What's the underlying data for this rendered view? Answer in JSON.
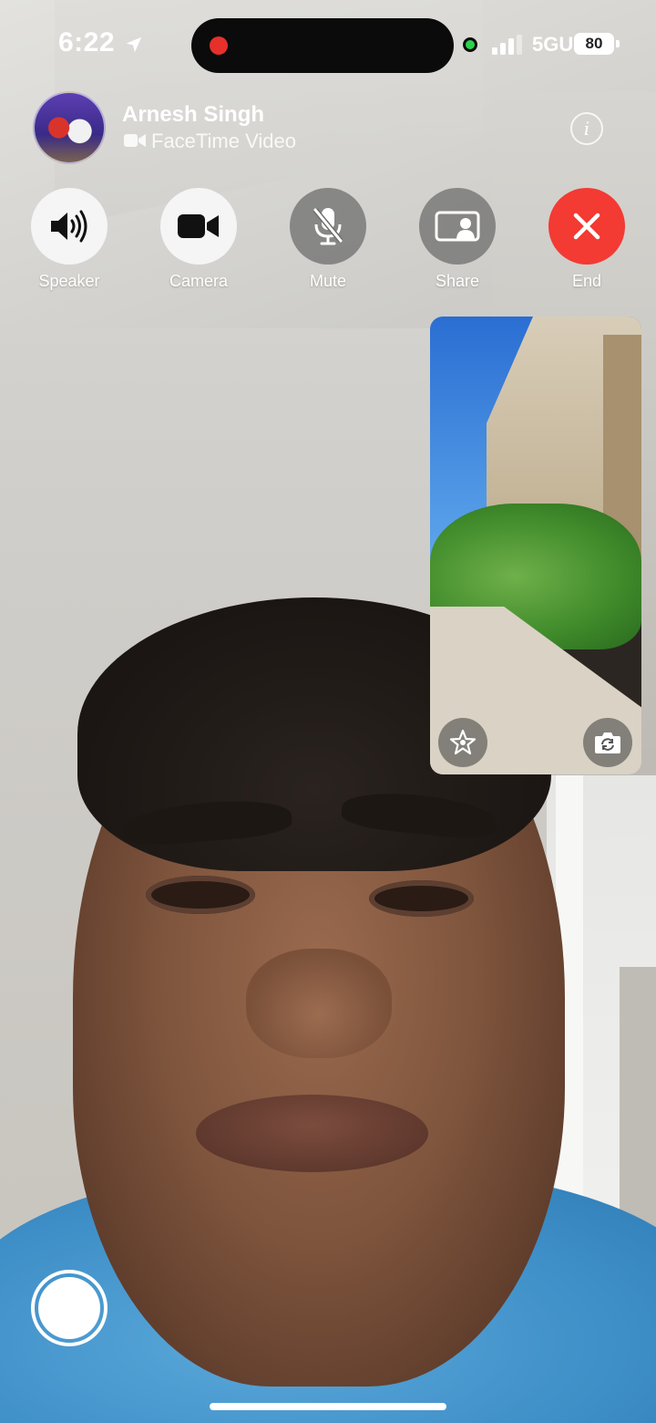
{
  "status_bar": {
    "time": "6:22",
    "network": "5GUC",
    "battery": "80",
    "battery_percent": 80,
    "recording_indicator_color": "#e5302b",
    "camera_in_use_color": "#2bd24b"
  },
  "call": {
    "caller_name": "Arnesh Singh",
    "call_type": "FaceTime Video"
  },
  "controls": [
    {
      "label": "Speaker",
      "icon": "speaker-icon",
      "state": "on"
    },
    {
      "label": "Camera",
      "icon": "video-camera-icon",
      "state": "on"
    },
    {
      "label": "Mute",
      "icon": "mic-off-icon",
      "state": "off"
    },
    {
      "label": "Share",
      "icon": "share-screen-icon",
      "state": "off"
    },
    {
      "label": "End",
      "icon": "close-icon",
      "state": "end"
    }
  ],
  "pip": {
    "effects_icon": "effects-star-icon",
    "flip_icon": "flip-camera-icon"
  },
  "colors": {
    "end_red": "#f33a33",
    "light_button": "#f5f5f5"
  }
}
